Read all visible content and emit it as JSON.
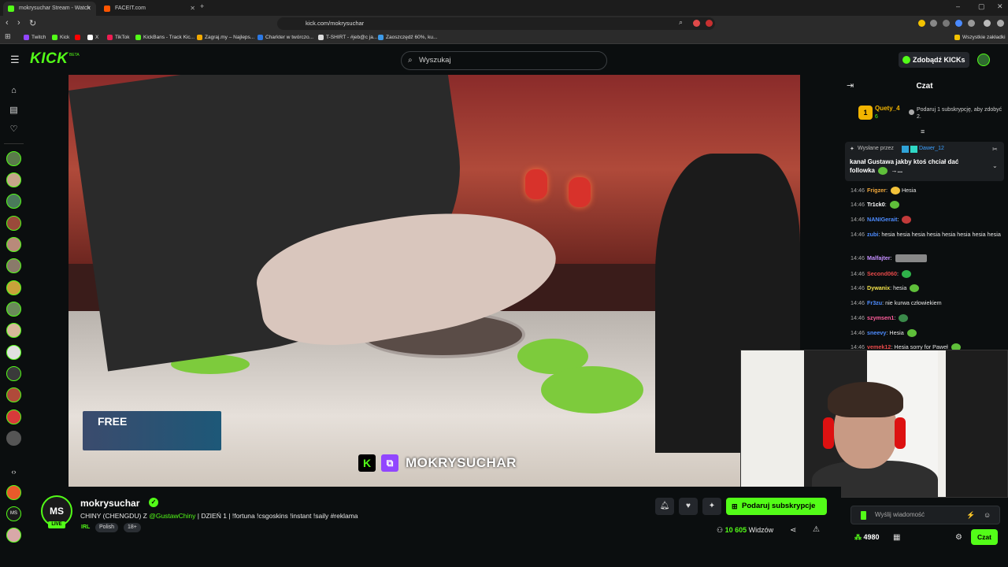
{
  "browser": {
    "tabs": [
      {
        "title": "mokrysuchar Stream - Watch",
        "favicon_color": "#53fc18",
        "active": true
      },
      {
        "title": "FACEIT.com",
        "favicon_color": "#ff5500",
        "active": false
      }
    ],
    "new_tab": "+",
    "url": "kick.com/mokrysuchar",
    "bookmarks": [
      {
        "label": "Twitch",
        "color": "#9146ff"
      },
      {
        "label": "Kick",
        "color": "#53fc18"
      },
      {
        "label": "",
        "color": "#ff0000"
      },
      {
        "label": "X",
        "color": "#ffffff"
      },
      {
        "label": "TikTok",
        "color": "#ee1d52"
      },
      {
        "label": "KickBans - Track Kic...",
        "color": "#53fc18"
      },
      {
        "label": "Zagraj.my – Najleps...",
        "color": "#f2a900"
      },
      {
        "label": "Charkter w twórczo...",
        "color": "#2b78e4"
      },
      {
        "label": "T-SHIRT - #jeb@c ja...",
        "color": "#dddddd"
      },
      {
        "label": "Zaoszczędź 60%, ku...",
        "color": "#3d9ae8"
      }
    ],
    "all_bookmarks": "Wszystkie zakładki"
  },
  "header": {
    "logo": "KICK",
    "beta": "BETA",
    "search_placeholder": "Wyszukaj",
    "kicks_button": "Zdobądź KICKs"
  },
  "video": {
    "promo_text": "FREE",
    "overlay_name": "MOKRYSUCHAR"
  },
  "chat": {
    "title": "Czat",
    "top_gifter": {
      "rank": "1",
      "name": "Quety_4",
      "count": "6",
      "promo": "Podaruj 1 subskrypcję, aby zdobyć 2."
    },
    "pinned": {
      "sent_by": "Wysłane przez",
      "user": "Dawer_12",
      "text": "kanał Gustawa jakby ktoś chciał dać followka",
      "more": "→..."
    },
    "messages": [
      {
        "time": "14:46",
        "user": "Frigzer",
        "color": "#f2a93b",
        "text": "Hesia",
        "emote": true
      },
      {
        "time": "14:46",
        "user": "Tr1ck0",
        "color": "#ffffff",
        "text": "",
        "emote": true
      },
      {
        "time": "14:46",
        "user": "NANIGerait",
        "color": "#4d8cff",
        "text": "",
        "emote": true
      },
      {
        "time": "14:46",
        "user": "zubi",
        "color": "#4d8cff",
        "text": "hesia hesia hesia hesia hesia hesia hesia hesia",
        "emote": false
      },
      {
        "time": "14:46",
        "user": "Malfajter",
        "color": "#c58fff",
        "text": "",
        "emote": true
      },
      {
        "time": "14:46",
        "user": "Second060",
        "color": "#e84a4a",
        "text": "",
        "emote": true
      },
      {
        "time": "14:46",
        "user": "Dywanix",
        "color": "#f2e14a",
        "text": "hesia",
        "emote": true
      },
      {
        "time": "14:46",
        "user": "Fr3zu",
        "color": "#4d8cff",
        "text": "nie kurwa człowiekiem",
        "emote": false
      },
      {
        "time": "14:46",
        "user": "szymsen1",
        "color": "#ff5d9b",
        "text": "",
        "emote": true
      },
      {
        "time": "14:46",
        "user": "sneevy",
        "color": "#4d8cff",
        "text": "Hesia",
        "emote": true
      },
      {
        "time": "14:46",
        "user": "vemek12",
        "color": "#e84a4a",
        "text": "Hesia sorry for Paweł",
        "emote": true
      }
    ],
    "input_placeholder": "Wyślij wiadomość",
    "points": "4980",
    "send_label": "Czat"
  },
  "stream": {
    "avatar_initials": "MS",
    "live_badge": "LIVE",
    "streamer": "mokrysuchar",
    "title_prefix": "CHINY (CHENGDU) Z ",
    "title_mention": "@GustawChiny",
    "title_suffix": " | DZIEŃ 1 | !fortuna !csgoskins !instant !saily #reklama",
    "category": "IRL",
    "tags": [
      "Polish",
      "18+"
    ],
    "sub_button": "Podaruj subskrypcje",
    "viewers_count": "10 605",
    "viewers_label": "Widzów"
  },
  "sidebar": {
    "avatar_colors": [
      "#5a7a4a",
      "#c7a58a",
      "#4a7a5a",
      "#9a4a3a",
      "#b88a7a",
      "#8a7a6a",
      "#c9a23a",
      "#6a8a5a",
      "#d8b89a",
      "#e0e0e0",
      "#3a3a3a",
      "#b04a3a",
      "#d83a3a",
      "#555555"
    ],
    "bottom_avatars": [
      {
        "initials": "",
        "color": "#e85a2a"
      },
      {
        "initials": "MS",
        "color": "#1a1a1a"
      },
      {
        "initials": "",
        "color": "#d8a8a8"
      }
    ]
  }
}
